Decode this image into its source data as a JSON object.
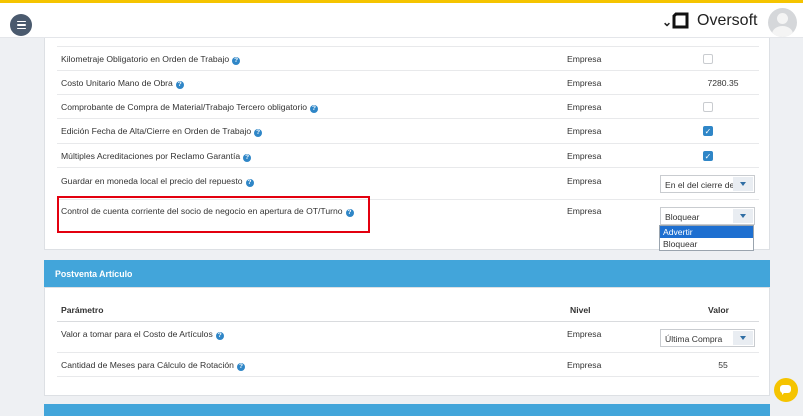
{
  "app": {
    "brand": "Oversoft"
  },
  "icons": {
    "menu": "hamburger-menu-icon",
    "help": "question-icon",
    "chat": "chat-bubble-icon",
    "check": "✓"
  },
  "colors": {
    "accent": "#42a5da",
    "top_strip": "#f5c400",
    "highlight": "#e3000f",
    "check": "#2f86c7"
  },
  "section1": {
    "rows": [
      {
        "label": "Kilometraje Obligatorio en Orden de Trabajo",
        "nivel": "Empresa",
        "type": "checkbox",
        "checked": false
      },
      {
        "label": "Costo Unitario Mano de Obra",
        "nivel": "Empresa",
        "type": "text",
        "value": "7280.35"
      },
      {
        "label": "Comprobante de Compra de Material/Trabajo Tercero obligatorio",
        "nivel": "Empresa",
        "type": "checkbox",
        "checked": false
      },
      {
        "label": "Edición Fecha de Alta/Cierre en Orden de Trabajo",
        "nivel": "Empresa",
        "type": "checkbox",
        "checked": true
      },
      {
        "label": "Múltiples Acreditaciones por Reclamo Garantía",
        "nivel": "Empresa",
        "type": "checkbox",
        "checked": true
      },
      {
        "label": "Guardar en moneda local el precio del repuesto",
        "nivel": "Empresa",
        "type": "select",
        "value": "En el del cierre de"
      },
      {
        "label": "Control de cuenta corriente del socio de negocio en apertura de OT/Turno",
        "nivel": "Empresa",
        "type": "select",
        "value": "Bloquear",
        "options": [
          "Advertir",
          "Bloquear"
        ],
        "highlighted_option": "Advertir"
      }
    ]
  },
  "section2": {
    "title": "Postventa Artículo",
    "headers": {
      "parametro": "Parámetro",
      "nivel": "Nivel",
      "valor": "Valor"
    },
    "rows": [
      {
        "label": "Valor a tomar para el Costo de Artículos",
        "nivel": "Empresa",
        "type": "select",
        "value": "Última Compra"
      },
      {
        "label": "Cantidad de Meses para Cálculo de Rotación",
        "nivel": "Empresa",
        "type": "text",
        "value": "55"
      }
    ]
  },
  "section3": {
    "title": ""
  }
}
